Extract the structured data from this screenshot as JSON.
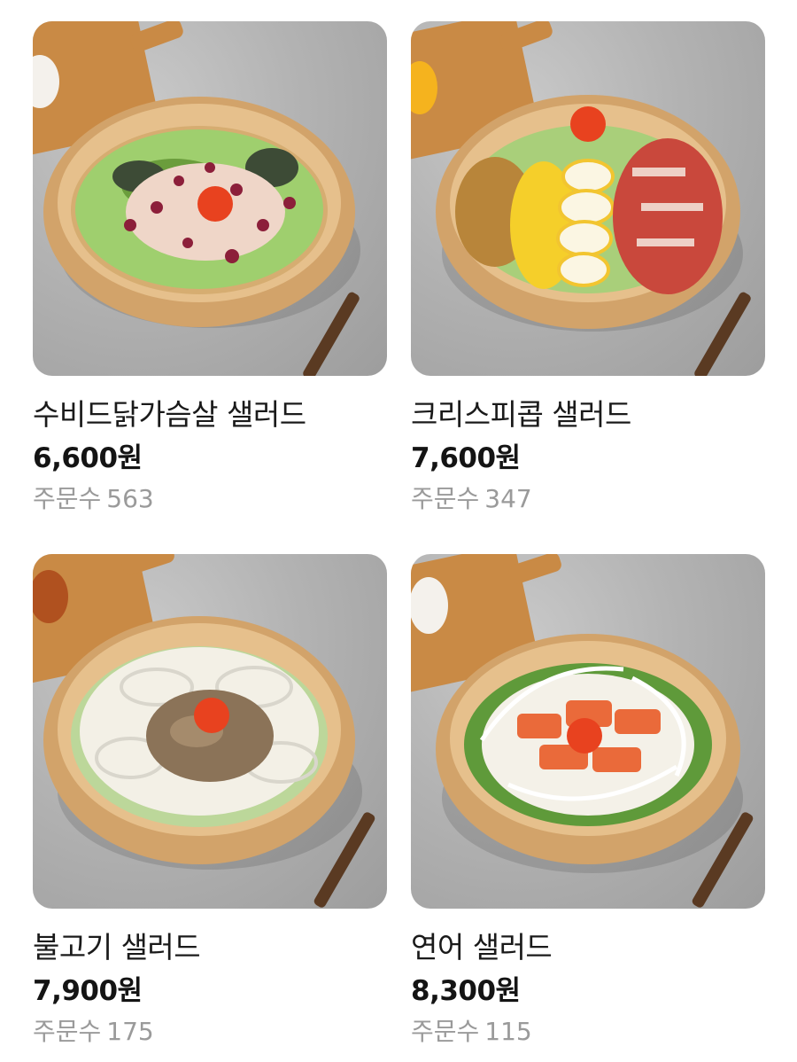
{
  "products": [
    {
      "name": "수비드닭가슴살 샐러드",
      "price": "6,600원",
      "orders_label": "주문수",
      "orders_count": "563",
      "image_icon": "chicken-breast-salad-photo"
    },
    {
      "name": "크리스피콥 샐러드",
      "price": "7,600원",
      "orders_label": "주문수",
      "orders_count": "347",
      "image_icon": "crispy-cobb-salad-photo"
    },
    {
      "name": "불고기 샐러드",
      "price": "7,900원",
      "orders_label": "주문수",
      "orders_count": "175",
      "image_icon": "bulgogi-salad-photo"
    },
    {
      "name": "연어 샐러드",
      "price": "8,300원",
      "orders_label": "주문수",
      "orders_count": "115",
      "image_icon": "salmon-salad-photo"
    }
  ],
  "colors": {
    "background": "#ffffff",
    "name_text": "#1a1a1a",
    "price_text": "#141414",
    "orders_text": "#9a9a9a"
  }
}
